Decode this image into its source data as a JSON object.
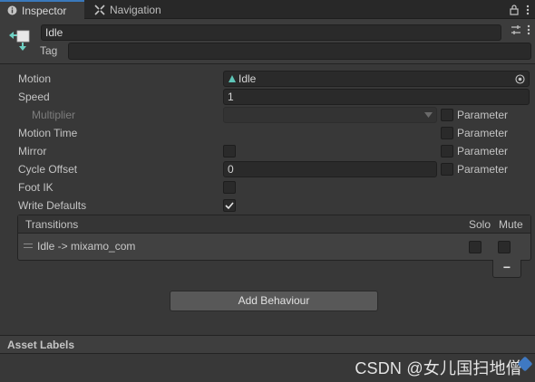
{
  "tabs": {
    "inspector": "Inspector",
    "navigation": "Navigation",
    "lock_icon": "lock-icon",
    "menu_icon": "kebab-menu-icon"
  },
  "header": {
    "state_name": "Idle",
    "tag_label": "Tag",
    "tag_value": "",
    "icon": "animator-state-icon",
    "settings_icon": "preset-icon",
    "menu_icon": "kebab-menu-icon"
  },
  "props": {
    "motion_label": "Motion",
    "motion_value": "Idle",
    "speed_label": "Speed",
    "speed_value": "1",
    "multiplier_label": "Multiplier",
    "motion_time_label": "Motion Time",
    "mirror_label": "Mirror",
    "cycle_offset_label": "Cycle Offset",
    "cycle_offset_value": "0",
    "foot_ik_label": "Foot IK",
    "write_defaults_label": "Write Defaults",
    "parameter_label": "Parameter"
  },
  "checks": {
    "mirror": false,
    "foot_ik": false,
    "write_defaults": true,
    "multiplier_param": false,
    "motion_time_param": false,
    "mirror_param": false,
    "cycle_offset_param": false
  },
  "transitions": {
    "title": "Transitions",
    "solo_label": "Solo",
    "mute_label": "Mute",
    "items": [
      {
        "name": "Idle -> mixamo_com",
        "solo": false,
        "mute": false
      }
    ],
    "remove_label": "−"
  },
  "add_behaviour_label": "Add Behaviour",
  "asset_labels_title": "Asset Labels",
  "watermark": "CSDN @女儿国扫地僧",
  "colors": {
    "background": "#383838",
    "tab_accent": "#3a79bb",
    "motion_icon": "#5ec6b8",
    "state_icon": "#6fd1c4"
  }
}
